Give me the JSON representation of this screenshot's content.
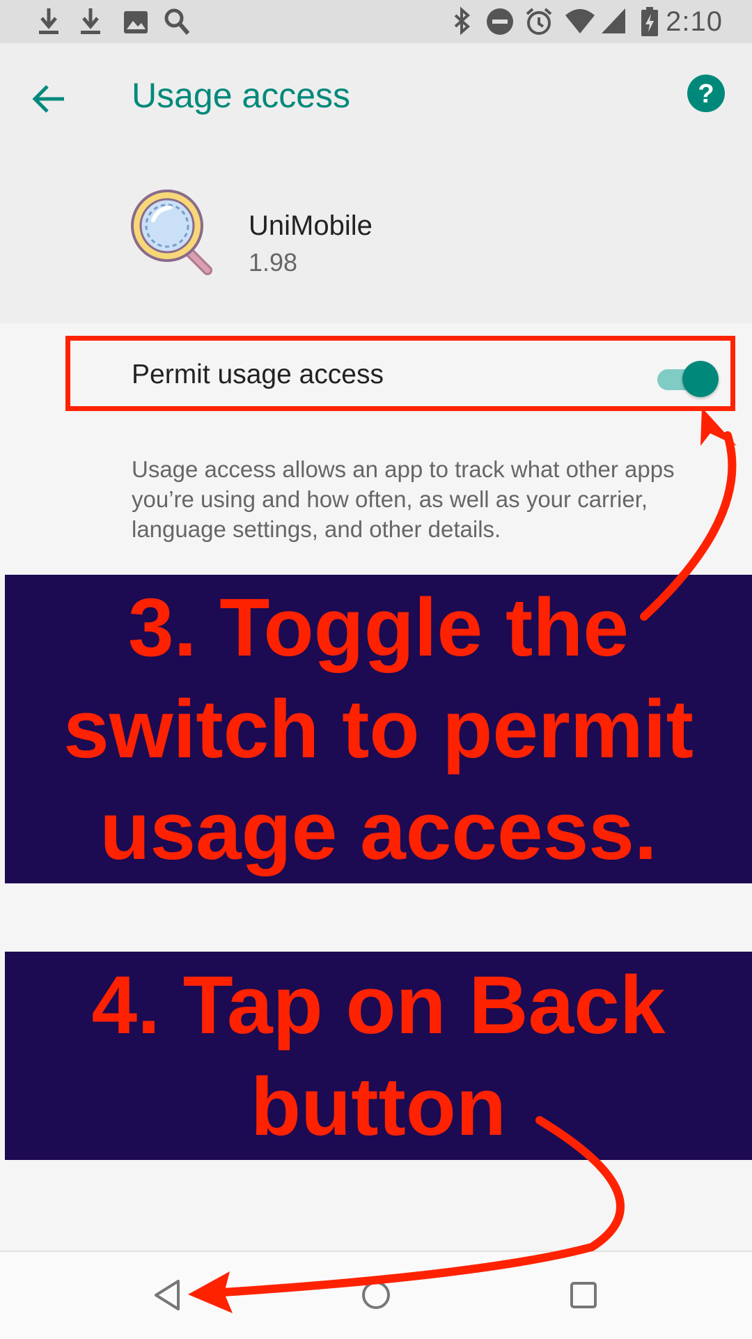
{
  "status_bar": {
    "time": "2:10",
    "left_icons": [
      "download-icon",
      "download-icon",
      "image-icon",
      "search-icon"
    ],
    "right_icons": [
      "bluetooth-icon",
      "do-not-disturb-icon",
      "alarm-icon",
      "wifi-icon",
      "signal-icon",
      "battery-charging-icon"
    ]
  },
  "header": {
    "title": "Usage access",
    "back_icon": "back-arrow-icon",
    "help_icon": "help-icon"
  },
  "app": {
    "name": "UniMobile",
    "version": "1.98",
    "icon": "magnifier-app-icon"
  },
  "setting": {
    "label": "Permit usage access",
    "enabled": true,
    "description": "Usage access allows an app to track what other apps you’re using and how often, as well as your carrier, language settings, and other details."
  },
  "annotations": {
    "step3": "3. Toggle the switch to permit usage access.",
    "step4": "4. Tap on Back button"
  },
  "nav_bar": {
    "buttons": [
      "back-nav-icon",
      "home-nav-icon",
      "recents-nav-icon"
    ]
  },
  "colors": {
    "accent": "#00897b",
    "annotation_red": "#ff2200",
    "banner_bg": "#1c0a52"
  }
}
